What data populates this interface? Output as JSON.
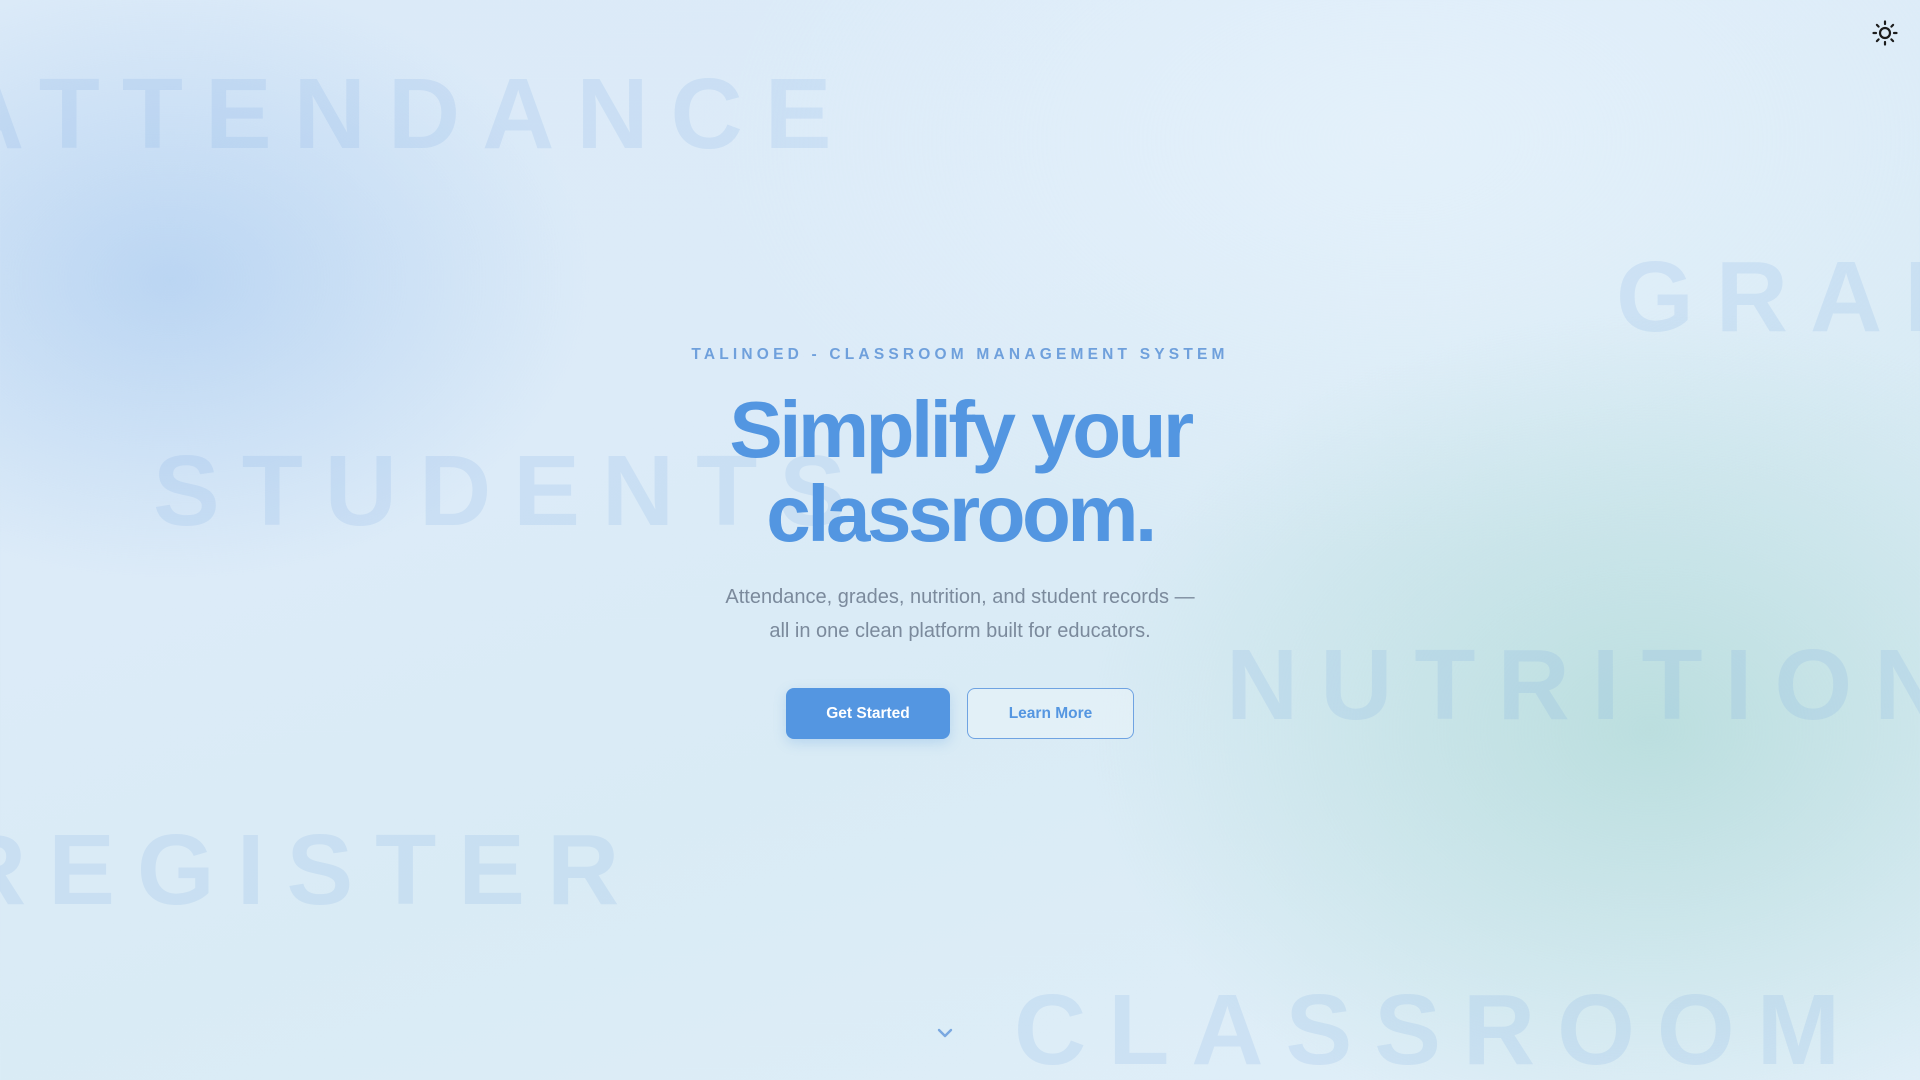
{
  "background_words": {
    "attendance": "ATTENDANCE",
    "grades": "GRADES",
    "students": "STUDENTS",
    "nutrition": "NUTRITION",
    "register": "REGISTER",
    "classroom": "CLASSROOM"
  },
  "header": {
    "theme_toggle_icon": "sun-icon"
  },
  "hero": {
    "eyebrow": "TALINOED - CLASSROOM MANAGEMENT SYSTEM",
    "headline_line1": "Simplify your",
    "headline_line2": "classroom.",
    "subtitle_line1": "Attendance, grades, nutrition, and student records —",
    "subtitle_line2": "all in one clean platform built for educators.",
    "primary_button": "Get Started",
    "secondary_button": "Learn More",
    "scroll_icon": "chevron-down-icon"
  },
  "colors": {
    "accent": "#5496e1",
    "eyebrow": "#6fa0dc",
    "subtitle": "#7b8a9c",
    "background": "#dbeaf8"
  }
}
